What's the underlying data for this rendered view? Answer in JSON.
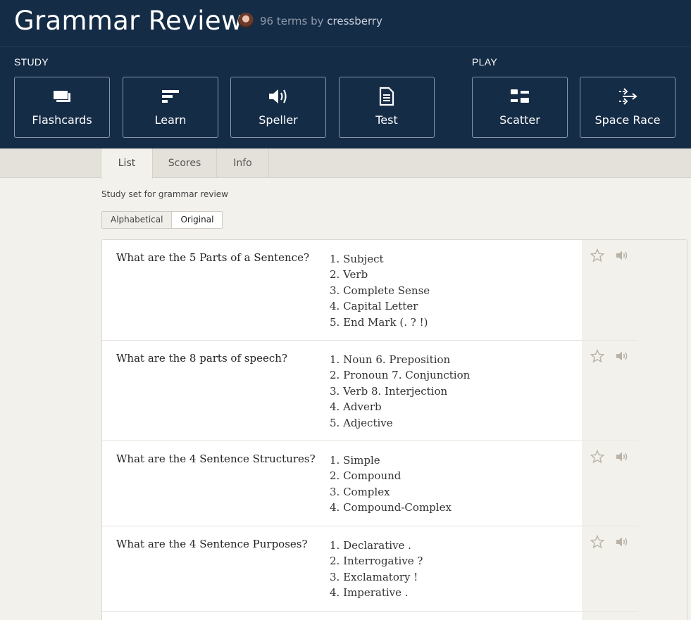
{
  "set": {
    "title": "Grammar Review",
    "term_count": "96 terms by",
    "author": "cressberry",
    "description": "Study set for grammar review"
  },
  "study": {
    "label": "STUDY",
    "modes": [
      {
        "label": "Flashcards",
        "icon": "flashcards-icon"
      },
      {
        "label": "Learn",
        "icon": "learn-icon"
      },
      {
        "label": "Speller",
        "icon": "speller-icon"
      },
      {
        "label": "Test",
        "icon": "test-icon"
      }
    ]
  },
  "play": {
    "label": "PLAY",
    "modes": [
      {
        "label": "Scatter",
        "icon": "scatter-icon"
      },
      {
        "label": "Space Race",
        "icon": "space-race-icon"
      }
    ]
  },
  "tabs": [
    {
      "label": "List",
      "active": true
    },
    {
      "label": "Scores",
      "active": false
    },
    {
      "label": "Info",
      "active": false
    }
  ],
  "sort": {
    "alphabetical": "Alphabetical",
    "original": "Original",
    "selected": "Original"
  },
  "terms": [
    {
      "term": "What are the 5 Parts of a Sentence?",
      "definition": [
        "1. Subject",
        "2. Verb",
        "3. Complete Sense",
        "4. Capital Letter",
        "5. End Mark (. ? !)"
      ]
    },
    {
      "term": "What are the 8 parts of speech?",
      "definition": [
        "1. Noun 6. Preposition",
        "2. Pronoun 7. Conjunction",
        "3. Verb 8. Interjection",
        "4. Adverb",
        "5. Adjective"
      ]
    },
    {
      "term": "What are the 4 Sentence Structures?",
      "definition": [
        "1. Simple",
        "2. Compound",
        "3. Complex",
        "4. Compound-Complex"
      ]
    },
    {
      "term": "What are the 4 Sentence Purposes?",
      "definition": [
        "1. Declarative .",
        "2. Interrogative ?",
        "3. Exclamatory !",
        "4. Imperative ."
      ]
    }
  ],
  "colors": {
    "header_bg": "#152c47",
    "page_bg": "#f3f1ec",
    "icon_muted": "#b9b2a6"
  }
}
